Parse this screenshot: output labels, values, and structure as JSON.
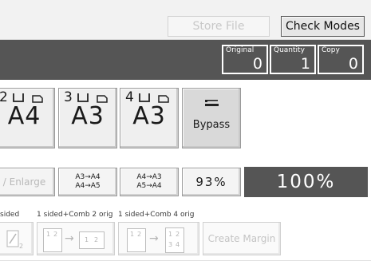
{
  "toolbar": {
    "store_file": "Store File",
    "check_modes": "Check Modes"
  },
  "counters": [
    {
      "label": "Original",
      "value": "0"
    },
    {
      "label": "Quantity",
      "value": "1"
    },
    {
      "label": "Copy",
      "value": "0"
    }
  ],
  "trays": [
    {
      "number": "2",
      "size": "A4"
    },
    {
      "number": "3",
      "size": "A3"
    },
    {
      "number": "4",
      "size": "A3"
    }
  ],
  "bypass": {
    "label": "Bypass"
  },
  "ratios": {
    "enlarge": "/ Enlarge",
    "a3_a4_line1": "A3→A4",
    "a3_a4_line2": "A4→A5",
    "a4_a3_line1": "A4→A3",
    "a4_a3_line2": "A5→A4",
    "preset_93": "93%",
    "current": "100%"
  },
  "combine": {
    "label_sided": "sided",
    "label_comb2": "1 sided+Comb 2 orig",
    "label_comb4": "1 sided+Comb 4 orig",
    "page_1": "1",
    "page_2": "2",
    "page_3": "3",
    "page_4": "4",
    "create_margin": "Create Margin"
  }
}
